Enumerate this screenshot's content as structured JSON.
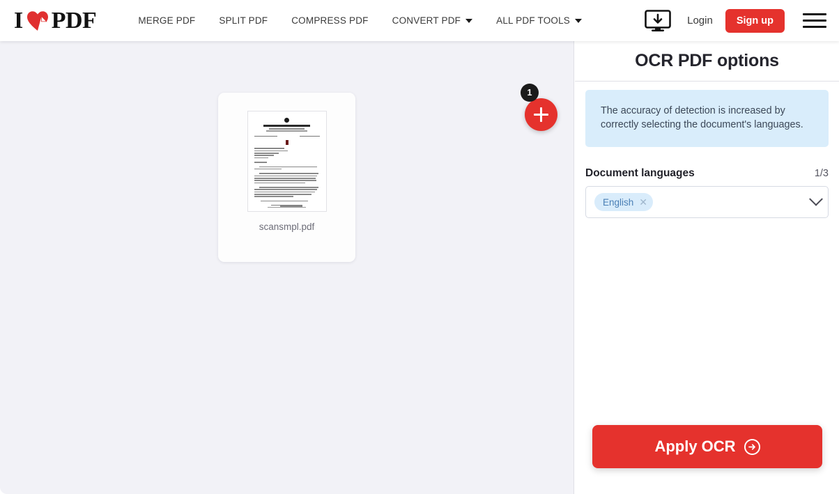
{
  "brand": {
    "name_before": "I",
    "name_after": "PDF",
    "heart_icon": "heart-icon",
    "accent_red": "#e5322d"
  },
  "nav": {
    "items": [
      {
        "label": "MERGE PDF",
        "has_caret": false
      },
      {
        "label": "SPLIT PDF",
        "has_caret": false
      },
      {
        "label": "COMPRESS PDF",
        "has_caret": false
      },
      {
        "label": "CONVERT PDF",
        "has_caret": true
      },
      {
        "label": "ALL PDF TOOLS",
        "has_caret": true
      }
    ]
  },
  "header_right": {
    "desktop_download_icon": "monitor-download-icon",
    "login_label": "Login",
    "signup_label": "Sign up",
    "menu_icon": "hamburger-menu-icon"
  },
  "workspace": {
    "file": {
      "name": "scansmpl.pdf",
      "thumbnail_alt": "scanned-letter-thumbnail"
    },
    "add_file_button": {
      "icon": "plus-icon",
      "badge_count": "1"
    }
  },
  "panel": {
    "title": "OCR PDF options",
    "info_text": "The accuracy of detection is increased by correctly selecting the document's languages.",
    "info_bg": "#d9edfb",
    "field": {
      "label": "Document languages",
      "counter": "1/3",
      "selected_tags": [
        {
          "label": "English",
          "remove_icon": "close-icon"
        }
      ],
      "chevron_icon": "chevron-down-icon"
    },
    "apply_button": {
      "label": "Apply OCR",
      "icon": "arrow-right-circle-icon"
    }
  }
}
